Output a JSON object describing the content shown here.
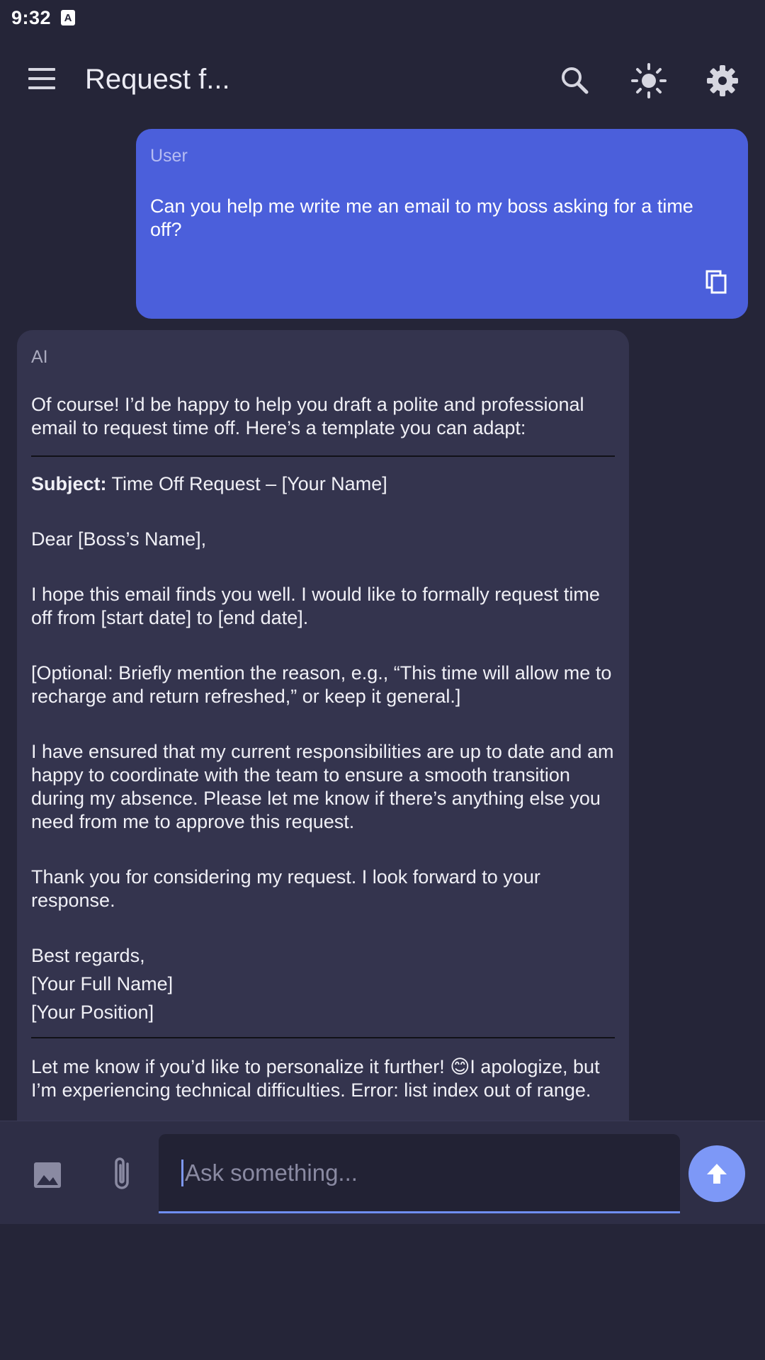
{
  "status_bar": {
    "time": "9:32",
    "notification_icon": "A"
  },
  "app_bar": {
    "title": "Request f...",
    "icons": [
      "menu-icon",
      "search-icon",
      "theme-brightness-icon",
      "settings-gear-icon"
    ]
  },
  "messages": {
    "user": {
      "role": "User",
      "text": "Can you help me write me an email to my boss asking for a time off?"
    },
    "ai": {
      "role": "AI",
      "intro": "Of course! I’d be happy to help you draft a polite and professional email to request time off. Here’s a template you can adapt:",
      "subject_label": "Subject:",
      "subject_value": " Time Off Request – [Your Name]",
      "greeting": "Dear [Boss’s Name],",
      "para1": "I hope this email finds you well. I would like to formally request time off from [start date] to [end date].",
      "para2": "[Optional: Briefly mention the reason, e.g., “This time will allow me to recharge and return refreshed,” or keep it general.]",
      "para3": "I have ensured that my current responsibilities are up to date and am happy to coordinate with the team to ensure a smooth transition during my absence. Please let me know if there’s anything else you need from me to approve this request.",
      "para4": "Thank you for considering my request. I look forward to your response.",
      "closing": "Best regards,",
      "sign_name": "[Your Full Name]",
      "sign_position": "[Your Position]",
      "outro": "Let me know if you’d like to personalize it further! 😊I apologize, but I’m experiencing technical difficulties. Error: list index out of range."
    }
  },
  "input": {
    "placeholder": "Ask something...",
    "icons": [
      "image-icon",
      "attachment-icon",
      "send-arrow-icon"
    ]
  },
  "colors": {
    "background": "#252538",
    "user_bubble": "#4b5fdb",
    "ai_bubble": "#34344e",
    "accent": "#7d98f7"
  }
}
